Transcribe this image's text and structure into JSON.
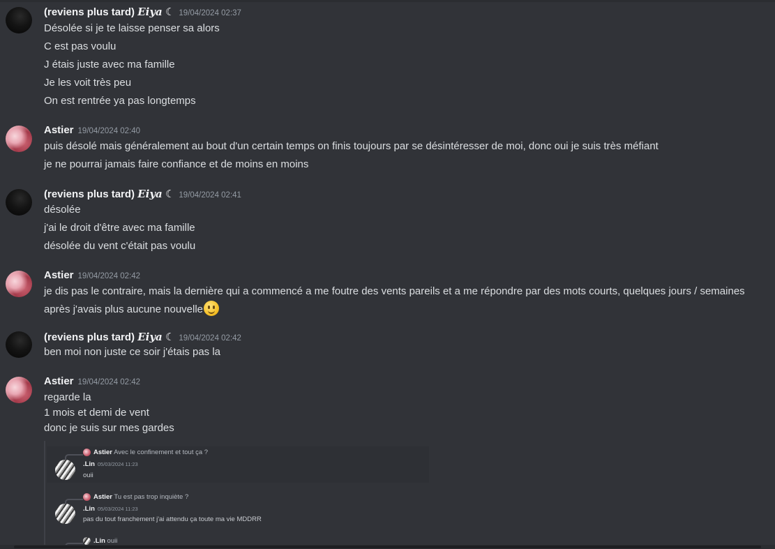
{
  "messages": [
    {
      "author_prefix": "(reviens plus tard) ",
      "author_styled": "𝑬𝒊𝒚𝒂",
      "author_suffix": " ☾",
      "timestamp": "19/04/2024 02:37",
      "lines": [
        "Désolée si je te laisse penser sa alors",
        "C est pas voulu",
        "J étais juste avec ma famille",
        "Je les voit très peu",
        "On est rentrée ya pas longtemps"
      ]
    },
    {
      "author": "Astier",
      "timestamp": "19/04/2024 02:40",
      "lines": [
        "puis désolé mais généralement au bout d'un certain temps on finis toujours par se désintéresser de moi, donc oui je suis très méfiant",
        "je ne pourrai jamais faire confiance et de moins en moins"
      ]
    },
    {
      "author_prefix": "(reviens plus tard) ",
      "author_styled": "𝑬𝒊𝒚𝒂",
      "author_suffix": " ☾",
      "timestamp": "19/04/2024 02:41",
      "lines": [
        "désolée",
        "j'ai le droit d'être avec ma famille",
        "désolée du vent c'était pas voulu"
      ]
    },
    {
      "author": "Astier",
      "timestamp": "19/04/2024 02:42",
      "lines": [
        "je dis pas le contraire, mais la dernière qui a commencé a me foutre des vents pareils et a me répondre par des mots courts, quelques jours / semaines",
        "après j'avais plus aucune nouvelle"
      ],
      "emoji": "slight-smile-emoji"
    },
    {
      "author_prefix": "(reviens plus tard) ",
      "author_styled": "𝑬𝒊𝒚𝒂",
      "author_suffix": " ☾",
      "timestamp": "19/04/2024 02:42",
      "lines": [
        "ben moi non juste ce soir j'étais pas la"
      ]
    },
    {
      "author": "Astier",
      "timestamp": "19/04/2024 02:42",
      "lines": [
        "regarde la",
        "1 mois et demi de vent",
        "donc je suis sur mes gardes"
      ]
    }
  ],
  "embedded_screenshot": {
    "items": [
      {
        "reply_to_author": "Astier",
        "reply_to_text": "Avec le confinement et tout ça ?",
        "author": ".Lin",
        "timestamp": "05/03/2024 11:23",
        "text": "ouii"
      },
      {
        "reply_to_author": "Astier",
        "reply_to_text": "Tu est pas trop inquiète ?",
        "author": ".Lin",
        "timestamp": "05/03/2024 11:23",
        "text": "pas du tout franchement j'ai attendu ça toute ma vie MDDRR"
      },
      {
        "reply_to_author": ".Lin",
        "reply_to_text": "ouii"
      }
    ]
  }
}
